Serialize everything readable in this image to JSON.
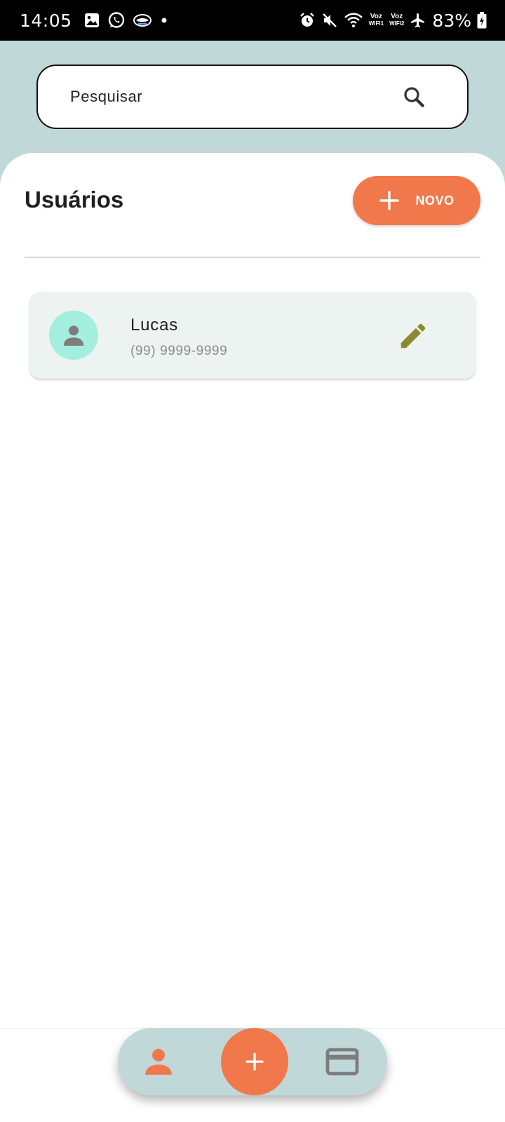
{
  "status_bar": {
    "time": "14:05",
    "left_icons": [
      "gallery-icon",
      "whatsapp-icon",
      "app-notification-icon",
      "dot-icon"
    ],
    "right_icons": [
      "alarm-icon",
      "mute-icon",
      "wifi-icon",
      "airplane-icon",
      "battery-charging-icon"
    ],
    "voz1_top": "Voz",
    "voz1_bottom": "WIFI1",
    "voz2_top": "Voz",
    "voz2_bottom": "WIFI2",
    "battery": "83%"
  },
  "search": {
    "placeholder": "Pesquisar",
    "value": "",
    "icon": "search-icon"
  },
  "page": {
    "title": "Usuários",
    "new_button_label": "NOVO",
    "new_button_icon": "plus-icon"
  },
  "users": [
    {
      "name": "Lucas",
      "phone": "(99) 9999-9999",
      "avatar_icon": "person-icon",
      "action_icon": "pencil-icon"
    }
  ],
  "bottom_nav": {
    "items": [
      {
        "icon": "person-icon",
        "active": true
      },
      {
        "icon": "plus-icon",
        "active": false
      },
      {
        "icon": "credit-card-icon",
        "active": false
      }
    ]
  },
  "colors": {
    "accent": "#f0784a",
    "header_bg": "#c0d8d8",
    "card_bg": "#edf3f0",
    "avatar_bg": "#a3eede",
    "edit_icon": "#8c8a2e",
    "muted_icon": "#7d7d7d"
  }
}
